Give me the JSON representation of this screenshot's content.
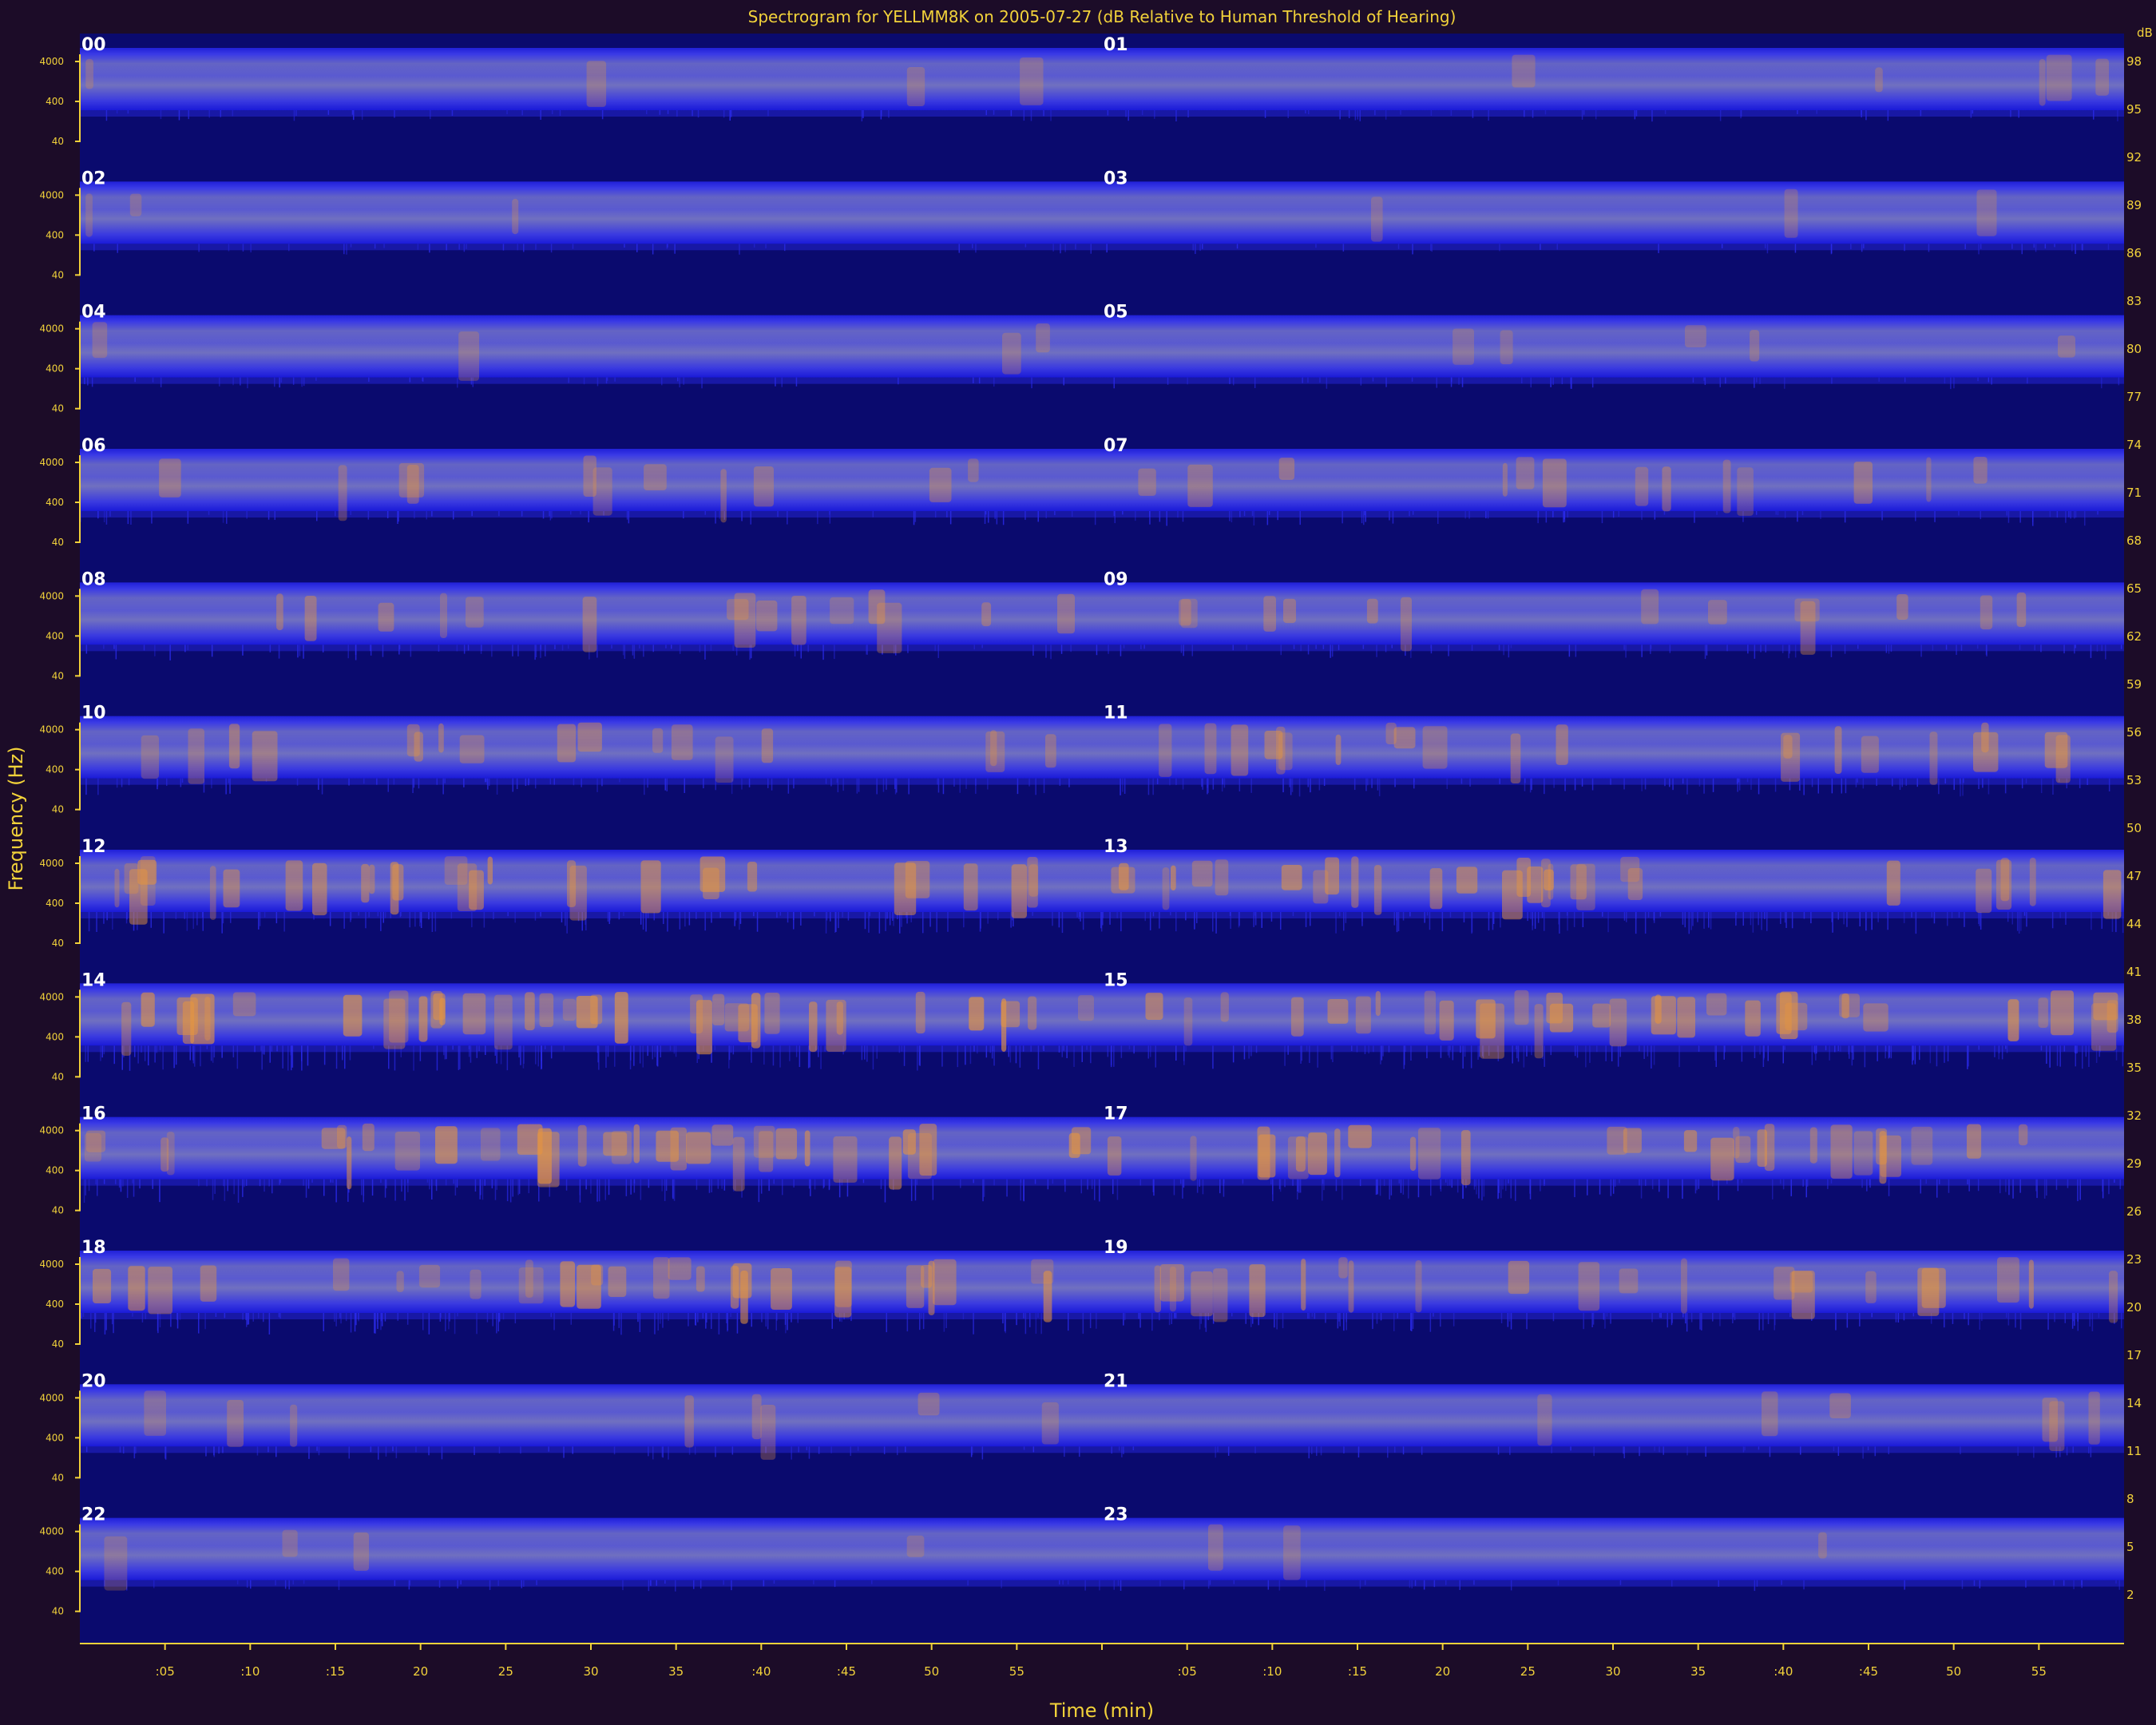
{
  "chart_data": {
    "type": "heatmap",
    "title": "Spectrogram for YELLMM8K on 2005-07-27 (dB Relative to Human Threshold of Hearing)",
    "xlabel": "Time (min)",
    "ylabel": "Frequency (Hz)",
    "x_ticks": [
      ":05",
      ":10",
      ":15",
      "20",
      "25",
      "30",
      "35",
      ":40",
      ":45",
      "50",
      "55",
      "",
      ":05",
      ":10",
      ":15",
      "20",
      "25",
      "30",
      "35",
      ":40",
      ":45",
      "50",
      "55"
    ],
    "y_ticks": [
      "4000",
      "400",
      "40"
    ],
    "colorbar_label": "dB",
    "colorbar_ticks": [
      "98",
      "95",
      "92",
      "89",
      "86",
      "83",
      "80",
      "77",
      "74",
      "71",
      "68",
      "65",
      "62",
      "59",
      "56",
      "53",
      "50",
      "47",
      "44",
      "41",
      "38",
      "35",
      "32",
      "29",
      "26",
      "23",
      "20",
      "17",
      "14",
      "11",
      "8",
      "5",
      "2"
    ],
    "hours": [
      "00",
      "01",
      "02",
      "03",
      "04",
      "05",
      "06",
      "07",
      "08",
      "09",
      "10",
      "11",
      "12",
      "13",
      "14",
      "15",
      "16",
      "17",
      "18",
      "19",
      "20",
      "21",
      "22",
      "23"
    ],
    "activity_by_hour": [
      0.1,
      0.12,
      0.08,
      0.07,
      0.09,
      0.12,
      0.25,
      0.3,
      0.35,
      0.3,
      0.4,
      0.5,
      0.7,
      0.7,
      0.9,
      0.8,
      0.8,
      0.7,
      0.7,
      0.55,
      0.2,
      0.15,
      0.1,
      0.08
    ],
    "colors": {
      "background": "#1c0c28",
      "low": "#0a0a6e",
      "mid": "#2a2ae8",
      "band": "#6868c8",
      "high": "#e8963c",
      "text": "#f2d23a",
      "hour_label": "#ffffff"
    }
  }
}
